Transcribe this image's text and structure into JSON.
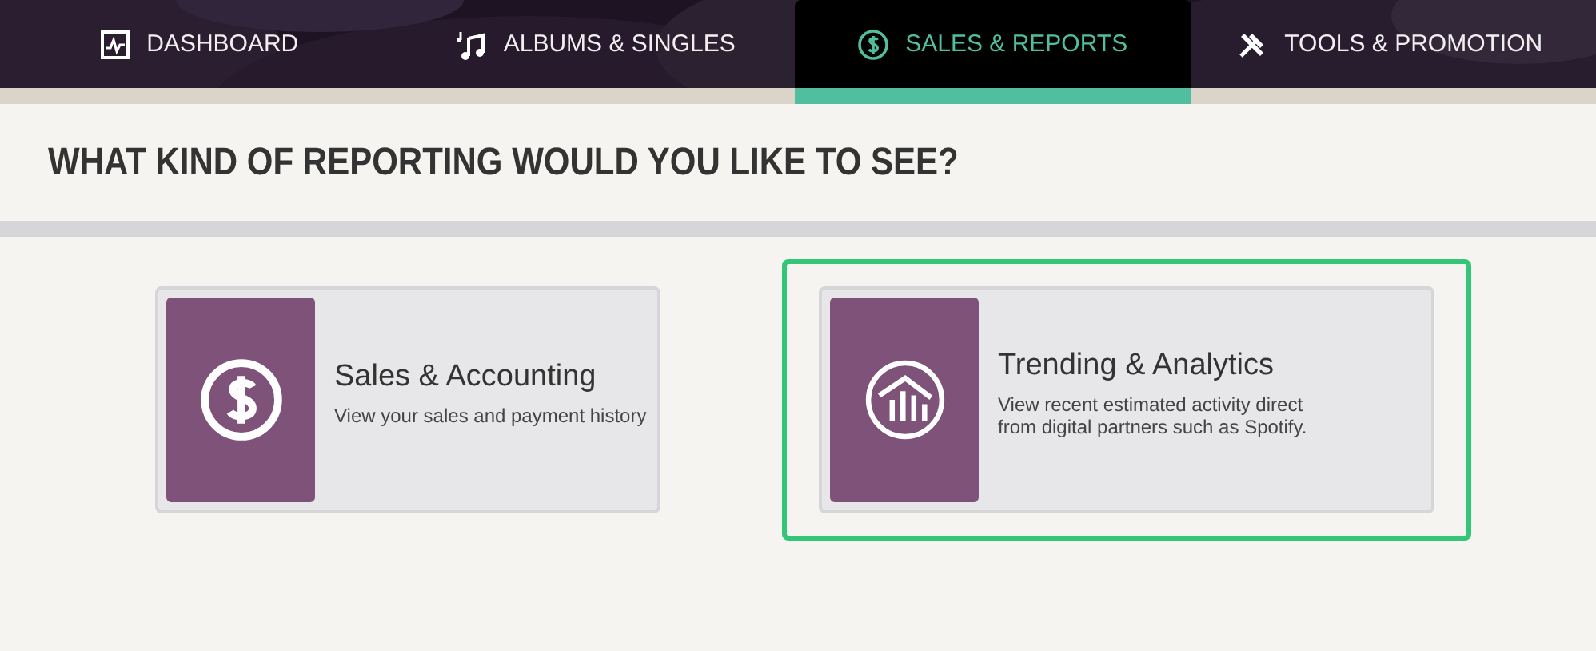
{
  "nav": {
    "tabs": [
      {
        "label": "DASHBOARD",
        "kind": "pulse",
        "selected": false
      },
      {
        "label": "ALBUMS & SINGLES",
        "kind": "music",
        "selected": false
      },
      {
        "label": "SALES & REPORTS",
        "kind": "dollar",
        "selected": true
      },
      {
        "label": "TOOLS & PROMOTION",
        "kind": "tools",
        "selected": false
      }
    ]
  },
  "heading": "WHAT KIND OF REPORTING WOULD YOU LIKE TO SEE?",
  "options": [
    {
      "title": "Sales & Accounting",
      "description": "View your sales and payment history",
      "kind": "dollar",
      "selected": false
    },
    {
      "title": "Trending & Analytics",
      "description": "View recent estimated activity direct from digital partners such as Spotify.",
      "kind": "chart",
      "selected": true
    }
  ]
}
